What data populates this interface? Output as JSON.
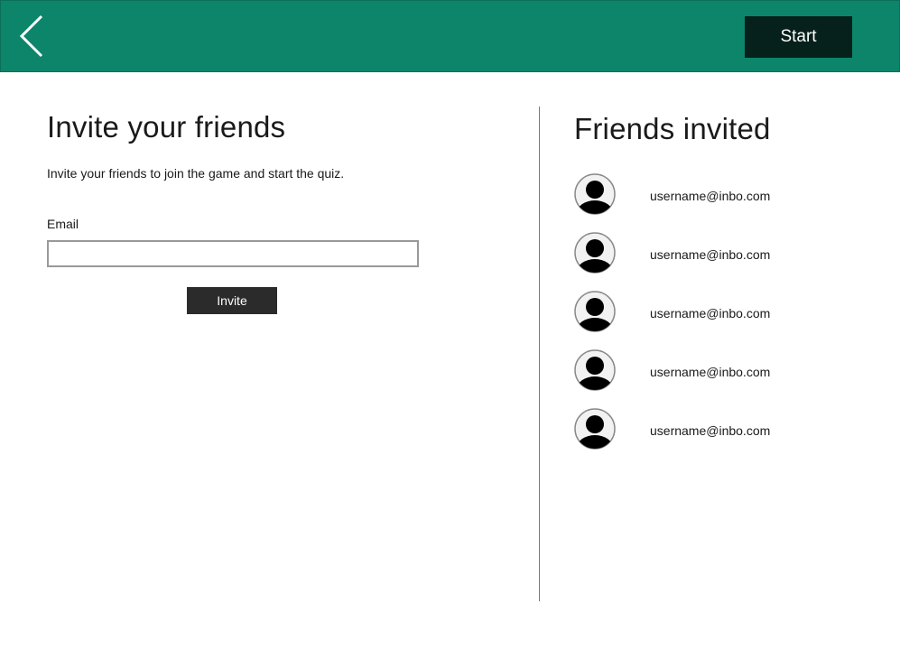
{
  "header": {
    "back_icon": "chevron-left-icon",
    "start_label": "Start"
  },
  "invite": {
    "title": "Invite your friends",
    "subtitle": "Invite your friends to join the game and start the quiz.",
    "email_label": "Email",
    "email_value": "",
    "email_placeholder": "",
    "invite_label": "Invite"
  },
  "friends": {
    "title": "Friends invited",
    "avatar_icon": "user-avatar-icon",
    "items": [
      {
        "email": "username@inbo.com"
      },
      {
        "email": "username@inbo.com"
      },
      {
        "email": "username@inbo.com"
      },
      {
        "email": "username@inbo.com"
      },
      {
        "email": "username@inbo.com"
      }
    ]
  },
  "colors": {
    "header_bg": "#0c856b",
    "start_bg": "#06201b",
    "invite_bg": "#2b2b2b"
  }
}
